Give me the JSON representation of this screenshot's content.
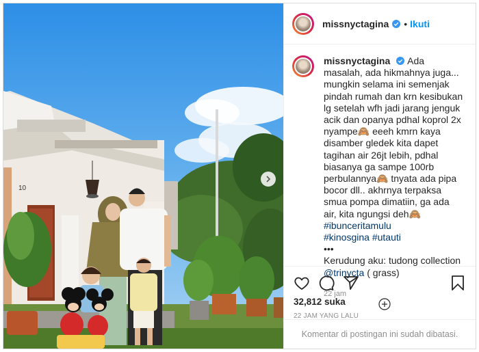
{
  "post": {
    "username": "missnyctagina",
    "follow_label": "Ikuti",
    "separator": "•",
    "caption_prefix": "Ada masalah, ada hikmahnya juga... mungkin selama ini semenjak pindah rumah dan krn kesibukan lg setelah wfh jadi jarang jenguk acik dan opanya pdhal koprol 2x nyampe🙈 eeeh kmrn kaya disamber gledek kita dapet tagihan air 26jt lebih, pdhal biasanya ga sampe 100rb perbulannya🙈 tnyata ada pipa bocor dll.. akhrnya terpaksa smua pompa dimatiin, ga ada air, kita ngungsi deh🙈 ",
    "hashtags": [
      "#ibunceritamulu",
      "#kinosgina",
      "#utauti"
    ],
    "ellipsis": "•••",
    "outfit_text": "Kerudung aku: tudong collection",
    "mention": "@trinycta",
    "mention_suffix": " ( grass)",
    "comment_time": "22 jam",
    "likes": "32,812 suka",
    "post_time": "22 JAM YANG LALU",
    "comments_disabled": "Komentar di postingan ini sudah dibatasi.",
    "house_number": "10"
  },
  "icons": {
    "verified": "verified-badge-icon",
    "next": "chevron-right-icon",
    "like": "heart-icon",
    "comment": "comment-icon",
    "share": "paper-plane-icon",
    "save": "bookmark-icon",
    "load_more": "plus-circle-icon"
  },
  "colors": {
    "link": "#00376b",
    "follow": "#0095f6",
    "verified": "#3897f0",
    "muted": "#8e8e8e"
  }
}
